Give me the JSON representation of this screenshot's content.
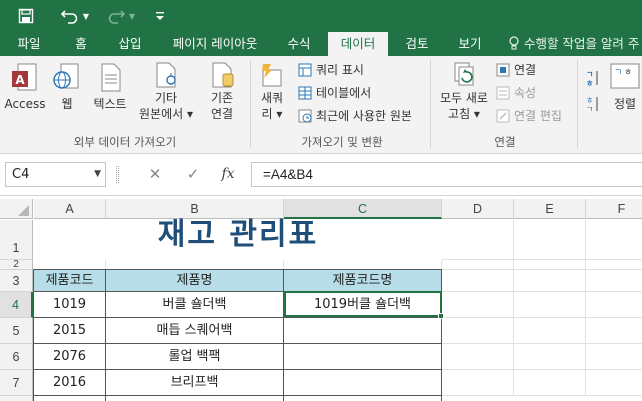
{
  "quick_access": {
    "save_icon": "save-icon",
    "undo_icon": "undo-icon",
    "redo_icon": "redo-icon",
    "customize_icon": "customize-qat-icon"
  },
  "tabs": [
    "파일",
    "홈",
    "삽입",
    "페이지 레이아웃",
    "수식",
    "데이터",
    "검토",
    "보기"
  ],
  "active_tab": "데이터",
  "tell_me": "수행할 작업을 알려 주",
  "ribbon": {
    "access": "Access",
    "web": "웹",
    "text": "텍스트",
    "other_sources_1": "기타",
    "other_sources_2": "원본에서 ▾",
    "existing_1": "기존",
    "existing_2": "연결",
    "group_external": "외부 데이터 가져오기",
    "new_query_1": "새쿼",
    "new_query_2": "리 ▾",
    "show_queries": "쿼리 표시",
    "from_table": "테이블에서",
    "recent_sources": "최근에 사용한 원본",
    "group_get_transform": "가져오기 및 변환",
    "refresh_all_1": "모두 새로",
    "refresh_all_2": "고침 ▾",
    "connections": "연결",
    "properties": "속성",
    "edit_links": "연결 편집",
    "group_connections": "연결",
    "sort_label": "정렬"
  },
  "formula_bar": {
    "name_box": "C4",
    "cancel_symbol": "✕",
    "enter_symbol": "✓",
    "fx_symbol": "fx",
    "formula": "=A4&B4"
  },
  "sheet": {
    "columns": [
      "A",
      "B",
      "C",
      "D",
      "E",
      "F"
    ],
    "selected_column": "C",
    "rows": [
      "1",
      "2",
      "3",
      "4",
      "5",
      "6",
      "7"
    ],
    "selected_row": "4",
    "title": "재고 관리표",
    "headers": [
      "제품코드",
      "제품명",
      "제품코드명"
    ],
    "data": [
      {
        "code": "1019",
        "name": "버클 숄더백",
        "combined": "1019버클 숄더백"
      },
      {
        "code": "2015",
        "name": "매듭 스퀘어백",
        "combined": ""
      },
      {
        "code": "2076",
        "name": "롤업 백팩",
        "combined": ""
      },
      {
        "code": "2016",
        "name": "브리프백",
        "combined": ""
      }
    ]
  },
  "colors": {
    "excel_green": "#217346",
    "header_fill": "#b7dee8",
    "title_color": "#1f4e79"
  }
}
